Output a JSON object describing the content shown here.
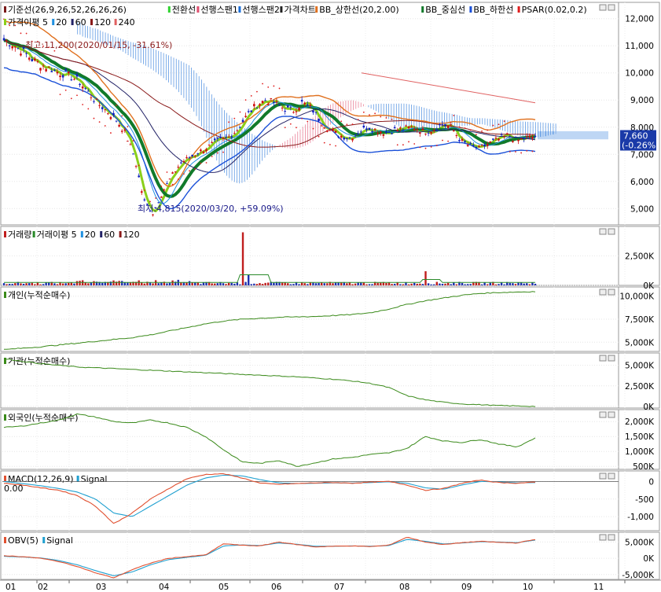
{
  "chart_data": {
    "type": "stock-multi-panel",
    "x_months": [
      "01",
      "02",
      "03",
      "04",
      "05",
      "06",
      "07",
      "08",
      "09",
      "10",
      "11"
    ],
    "panels": [
      {
        "key": "price",
        "legend": [
          {
            "text": "기준선(26,9,26,52,26,26,26)",
            "color": "#7a1a1a"
          },
          {
            "text": "전환선",
            "color": "#2fd22f"
          },
          {
            "text": "선행스팬1",
            "color": "#e05070"
          },
          {
            "text": "선행스팬2",
            "color": "#1a6ed8"
          },
          {
            "text": "가격차트",
            "color": "#222222"
          },
          {
            "text": "BB_상한선(20,2.00)",
            "color": "#e0701e"
          },
          {
            "text": "BB_중심선",
            "color": "#117a2a"
          },
          {
            "text": "BB_하한선",
            "color": "#1a50d8"
          },
          {
            "text": "PSAR(0.02,0.2)",
            "color": "#e01e1e"
          }
        ],
        "legend2": [
          {
            "text": "가격이평 5",
            "color": "#8acf1a"
          },
          {
            "text": "20",
            "color": "#2090e0"
          },
          {
            "text": "60",
            "color": "#222266"
          },
          {
            "text": "120",
            "color": "#8a1a1a"
          },
          {
            "text": "240",
            "color": "#e06060"
          }
        ],
        "yticks": [
          "12,000",
          "11,000",
          "10,000",
          "9,000",
          "8,000",
          "7,000",
          "6,000",
          "5,000"
        ],
        "ylim": [
          4400,
          12600
        ],
        "last_value": "7,660",
        "last_change": "(-0.26%)",
        "high_annotation": "최고:11,200(2020/01/15, -31.61%)",
        "low_annotation": "최저:4,815(2020/03/20, +59.09%)",
        "close_series": [
          11200,
          11050,
          10800,
          10500,
          10300,
          10150,
          10000,
          9900,
          9700,
          9300,
          8900,
          8600,
          8300,
          7800,
          6900,
          5300,
          4815,
          5600,
          6200,
          6700,
          6900,
          7100,
          7300,
          7500,
          7600,
          7900,
          8400,
          8800,
          9000,
          8900,
          8700,
          8600,
          8900,
          8700,
          8200,
          7900,
          7700,
          7600,
          7800,
          8000,
          7900,
          7800,
          7900,
          7950,
          8000,
          7850,
          7900,
          8100,
          8000,
          7500,
          7300,
          7200,
          7400,
          7550,
          7700,
          7500,
          7600,
          7660
        ]
      },
      {
        "key": "volume",
        "legend": [
          {
            "text": "거래량",
            "color": "#c01e1e"
          },
          {
            "text": "거래이평 5",
            "color": "#2a8a2a"
          },
          {
            "text": "20",
            "color": "#2090e0"
          },
          {
            "text": "60",
            "color": "#222266"
          },
          {
            "text": "120",
            "color": "#8a1a1a"
          }
        ],
        "yticks": [
          "2,500K",
          "0K"
        ],
        "ylim": [
          0,
          5000
        ]
      },
      {
        "key": "individual",
        "legend": [
          {
            "text": "개인(누적순매수)",
            "color": "#3a8a1a"
          }
        ],
        "yticks": [
          "10,000K",
          "7,500K",
          "5,000K"
        ],
        "ylim": [
          4000,
          11000
        ],
        "series": [
          4200,
          4350,
          4500,
          4700,
          4900,
          5100,
          5300,
          5500,
          5800,
          6200,
          6600,
          7000,
          7300,
          7500,
          7600,
          7700,
          7750,
          7800,
          7900,
          8000,
          8200,
          8600,
          9100,
          9500,
          9800,
          10100,
          10300,
          10400,
          10450,
          10500
        ]
      },
      {
        "key": "institution",
        "legend": [
          {
            "text": "기관(누적순매수)",
            "color": "#3a8a1a"
          }
        ],
        "yticks": [
          "5,000K",
          "2,500K",
          "0K"
        ],
        "ylim": [
          -200,
          6500
        ],
        "series": [
          5800,
          5500,
          5200,
          5000,
          4800,
          4700,
          4600,
          4500,
          4400,
          4300,
          4200,
          4100,
          4000,
          3900,
          3800,
          3700,
          3600,
          3450,
          3300,
          3100,
          2800,
          2300,
          1300,
          800,
          500,
          300,
          200,
          100,
          50,
          0
        ]
      },
      {
        "key": "foreign",
        "legend": [
          {
            "text": "외국인(누적순매수)",
            "color": "#3a8a1a"
          }
        ],
        "yticks": [
          "2,000K",
          "1,500K",
          "1,000K",
          "500K"
        ],
        "ylim": [
          400,
          2400
        ],
        "series": [
          1800,
          1850,
          1950,
          2050,
          2250,
          2150,
          2000,
          1950,
          2050,
          1950,
          1800,
          1500,
          1050,
          650,
          600,
          700,
          500,
          620,
          750,
          800,
          900,
          950,
          1100,
          1500,
          1350,
          1300,
          1400,
          1250,
          1150,
          1450
        ]
      },
      {
        "key": "macd",
        "legend": [
          {
            "text": "MACD(12,26,9)",
            "color": "#e05030"
          },
          {
            "text": "Signal",
            "color": "#20a0d0"
          }
        ],
        "level": "0.00",
        "yticks": [
          "0",
          "-500",
          "-1,000"
        ],
        "ylim": [
          -1400,
          300
        ],
        "series": [
          -50,
          -100,
          -180,
          -250,
          -400,
          -700,
          -1200,
          -900,
          -500,
          -200,
          80,
          200,
          220,
          100,
          -50,
          -80,
          -60,
          -40,
          -30,
          -50,
          -20,
          0,
          -100,
          -250,
          -200,
          -50,
          40,
          -30,
          -50,
          -20
        ],
        "signal": [
          0,
          -60,
          -120,
          -200,
          -300,
          -500,
          -900,
          -1000,
          -700,
          -400,
          -100,
          100,
          180,
          160,
          50,
          -40,
          -60,
          -50,
          -40,
          -45,
          -30,
          -10,
          -50,
          -180,
          -220,
          -100,
          0,
          -10,
          -40,
          -30
        ]
      },
      {
        "key": "obv",
        "legend": [
          {
            "text": "OBV(5)",
            "color": "#e05030"
          },
          {
            "text": "Signal",
            "color": "#20a0d0"
          }
        ],
        "yticks": [
          "5,000K",
          "0K",
          "-5,000K"
        ],
        "ylim": [
          -6500,
          8000
        ],
        "series": [
          800,
          500,
          0,
          -1000,
          -2500,
          -4500,
          -6000,
          -3500,
          -1500,
          0,
          500,
          1000,
          4500,
          4000,
          3800,
          5000,
          4200,
          3500,
          3700,
          3800,
          3600,
          4000,
          6500,
          5000,
          4200,
          4800,
          5200,
          4900,
          4700,
          5800
        ],
        "signal": [
          600,
          400,
          100,
          -700,
          -2000,
          -3800,
          -5400,
          -4200,
          -2000,
          -400,
          300,
          900,
          3800,
          4100,
          3900,
          4700,
          4300,
          3700,
          3700,
          3800,
          3700,
          3900,
          5800,
          5200,
          4400,
          4700,
          5100,
          5000,
          4800,
          5600
        ]
      }
    ]
  }
}
